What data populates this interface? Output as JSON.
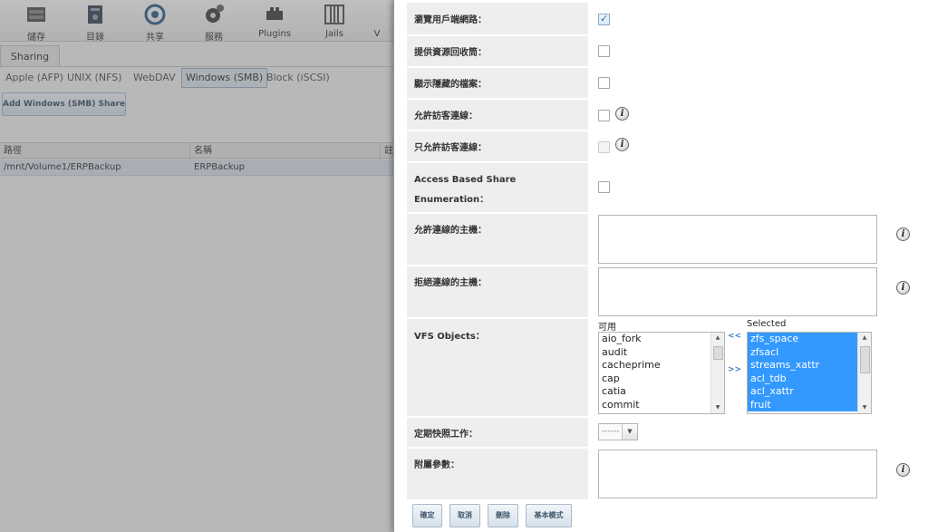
{
  "topbar": {
    "items": [
      {
        "label": "儲存",
        "icon": "storage-icon"
      },
      {
        "label": "目錄",
        "icon": "directory-icon"
      },
      {
        "label": "共享",
        "icon": "sharing-icon"
      },
      {
        "label": "服務",
        "icon": "services-icon"
      },
      {
        "label": "Plugins",
        "icon": "plugins-icon"
      },
      {
        "label": "Jails",
        "icon": "jails-icon"
      },
      {
        "label": "V",
        "icon": "vm-icon"
      }
    ]
  },
  "sharing_tab": "Sharing",
  "subtabs": [
    "Apple (AFP)",
    "UNIX (NFS)",
    "WebDAV",
    "Windows (SMB)",
    "Block (iSCSI)"
  ],
  "active_subtab": "Windows (SMB)",
  "add_button": "Add Windows (SMB) Share",
  "table": {
    "headers": [
      "路徑",
      "名稱",
      "註"
    ],
    "rows": [
      [
        "/mnt/Volume1/ERPBackup",
        "ERPBackup"
      ]
    ]
  },
  "form": {
    "browse_network": {
      "label": "瀏覽用戶端網路：",
      "checked": true
    },
    "recycle_bin": {
      "label": "提供資源回收筒：",
      "checked": false
    },
    "show_hidden": {
      "label": "顯示隱藏的檔案：",
      "checked": false
    },
    "allow_guest": {
      "label": "允許訪客連線：",
      "checked": false
    },
    "guest_only": {
      "label": "只允許訪客連線：",
      "checked": false,
      "disabled": true
    },
    "abse": {
      "label_line1": "Access Based Share",
      "label_line2": "Enumeration：",
      "checked": false
    },
    "hosts_allow": {
      "label": "允許連線的主機：",
      "value": ""
    },
    "hosts_deny": {
      "label": "拒絕連線的主機：",
      "value": ""
    },
    "vfs": {
      "label": "VFS Objects：",
      "available_title": "可用",
      "selected_title": "Selected",
      "available": [
        "aio_fork",
        "audit",
        "cacheprime",
        "cap",
        "catia",
        "commit"
      ],
      "selected": [
        "zfs_space",
        "zfsacl",
        "streams_xattr",
        "acl_tdb",
        "acl_xattr",
        "fruit"
      ],
      "add_label": ">>",
      "remove_label": "<<"
    },
    "periodic_snapshot": {
      "label": "定期快照工作：",
      "value": "------"
    },
    "aux_params": {
      "label": "附屬參數：",
      "value": ""
    }
  },
  "buttons": {
    "ok": "確定",
    "cancel": "取消",
    "delete": "刪除",
    "basic_mode": "基本模式"
  },
  "colors": {
    "selection": "#3399ff",
    "label_bg": "#eeeeee",
    "overlay": "rgba(90,90,90,0.38)"
  }
}
